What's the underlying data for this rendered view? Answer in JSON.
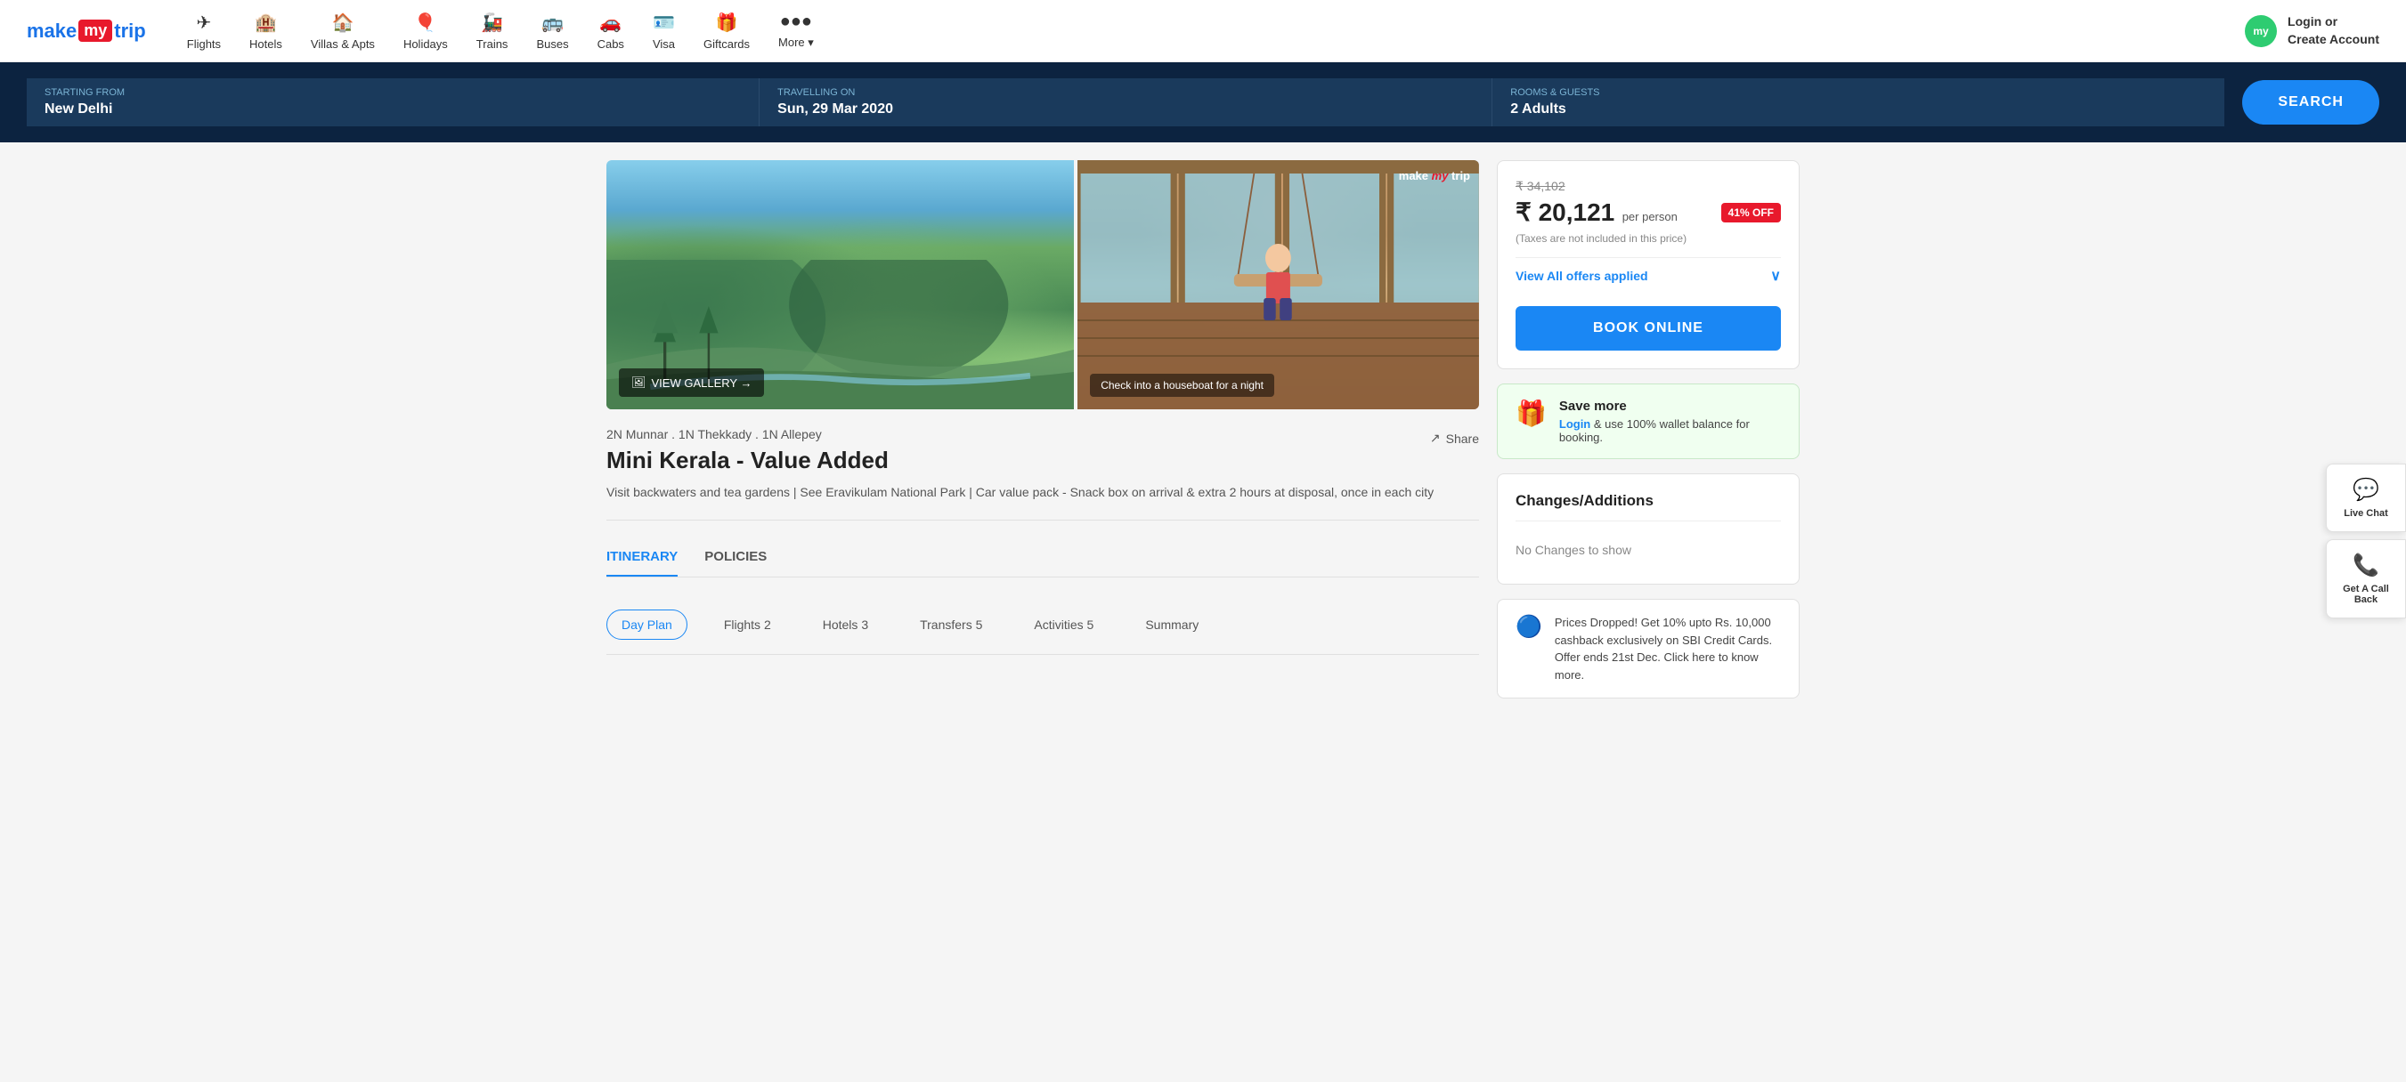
{
  "header": {
    "logo": {
      "make": "make",
      "my": "my",
      "trip": "trip"
    },
    "nav": [
      {
        "id": "flights",
        "label": "Flights",
        "icon": "✈"
      },
      {
        "id": "hotels",
        "label": "Hotels",
        "icon": "🏨"
      },
      {
        "id": "villas",
        "label": "Villas & Apts",
        "icon": "🏠"
      },
      {
        "id": "holidays",
        "label": "Holidays",
        "icon": "🎈"
      },
      {
        "id": "trains",
        "label": "Trains",
        "icon": "🚂"
      },
      {
        "id": "buses",
        "label": "Buses",
        "icon": "🚌"
      },
      {
        "id": "cabs",
        "label": "Cabs",
        "icon": "🚗"
      },
      {
        "id": "visa",
        "label": "Visa",
        "icon": "🪪"
      },
      {
        "id": "giftcards",
        "label": "Giftcards",
        "icon": "🎁"
      },
      {
        "id": "more",
        "label": "More ▾",
        "icon": "●●●"
      }
    ],
    "login": {
      "avatar_text": "my",
      "label_line1": "Login or",
      "label_line2": "Create Account"
    }
  },
  "search_bar": {
    "starting_from_label": "STARTING FROM",
    "starting_from_value": "New Delhi",
    "travelling_on_label": "TRAVELLING ON",
    "travelling_on_value": "Sun, 29 Mar 2020",
    "rooms_guests_label": "ROOMS & GUESTS",
    "rooms_guests_value": "2 Adults",
    "search_btn": "SEARCH"
  },
  "gallery": {
    "view_gallery_btn": "VIEW GALLERY →",
    "caption": "Check into a houseboat for a night",
    "mmt_badge": "make my trip"
  },
  "package": {
    "subtitle": "2N Munnar . 1N Thekkady . 1N Allepey",
    "title": "Mini Kerala - Value Added",
    "description": "Visit backwaters and tea gardens | See Eravikulam National Park | Car value pack - Snack box on arrival & extra 2 hours at disposal, once in each city",
    "share_btn": "Share"
  },
  "tabs": [
    {
      "id": "itinerary",
      "label": "ITINERARY",
      "active": true
    },
    {
      "id": "policies",
      "label": "POLICIES",
      "active": false
    }
  ],
  "filter_tabs": [
    {
      "id": "day-plan",
      "label": "Day Plan",
      "count": "",
      "active": true
    },
    {
      "id": "flights",
      "label": "Flights",
      "count": " 2",
      "active": false
    },
    {
      "id": "hotels",
      "label": "Hotels",
      "count": " 3",
      "active": false
    },
    {
      "id": "transfers",
      "label": "Transfers",
      "count": " 5",
      "active": false
    },
    {
      "id": "activities",
      "label": "Activities",
      "count": " 5",
      "active": false
    },
    {
      "id": "summary",
      "label": "Summary",
      "count": "",
      "active": false
    }
  ],
  "sidebar": {
    "original_price": "₹ 34,102",
    "current_price": "₹ 20,121",
    "per_person": "per person",
    "discount": "41% OFF",
    "tax_note": "(Taxes are not included in this price)",
    "offers_label": "View All offers applied",
    "book_btn": "BOOK ONLINE",
    "save_card": {
      "title": "Save more",
      "text_pre": "",
      "login_link": "Login",
      "text_post": " & use 100% wallet balance for booking."
    },
    "changes_title": "Changes/Additions",
    "no_changes": "No Changes to show",
    "promo_text": "Prices Dropped! Get 10% upto Rs. 10,000 cashback exclusively on SBI Credit Cards. Offer ends 21st Dec. Click here to know more."
  },
  "side_buttons": [
    {
      "id": "live-chat",
      "icon": "💬",
      "label": "Live Chat"
    },
    {
      "id": "get-callback",
      "icon": "📞",
      "label": "Get A Call Back"
    }
  ]
}
